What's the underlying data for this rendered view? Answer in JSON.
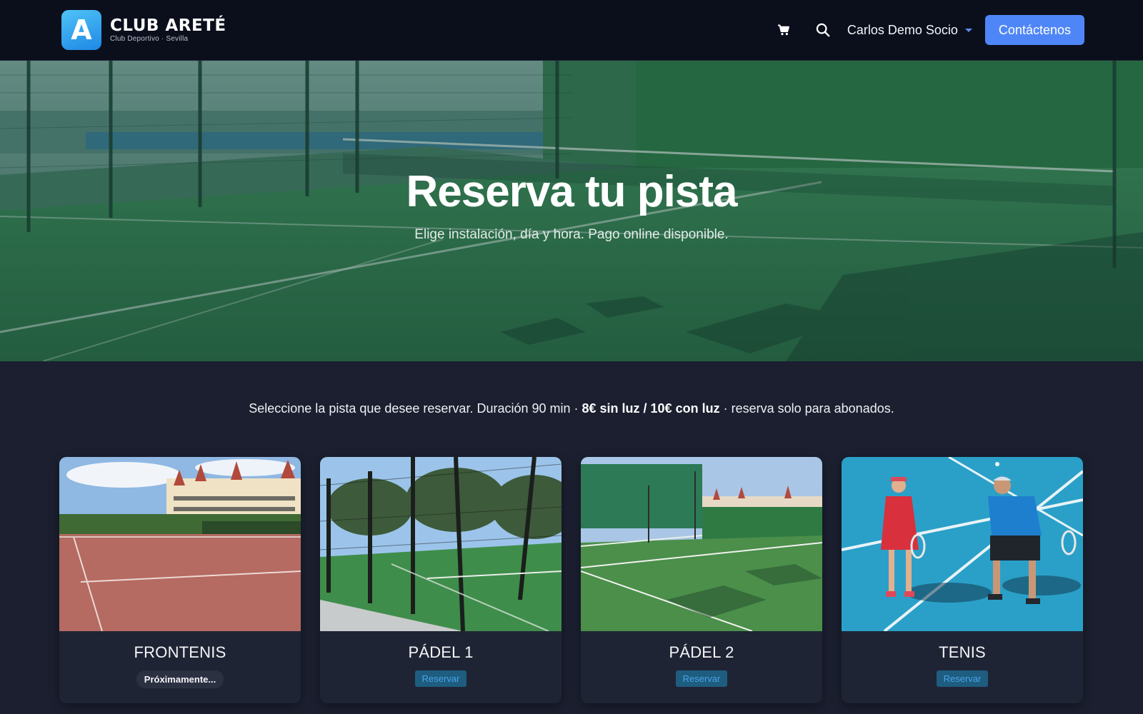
{
  "brand": {
    "logo_letter": "A",
    "name": "CLUB ARETÉ",
    "tagline": "Club Deportivo · Sevilla"
  },
  "nav": {
    "cart_icon": "cart-icon",
    "search_icon": "search-icon",
    "user_name": "Carlos Demo Socio",
    "contact_label": "Contáctenos"
  },
  "hero": {
    "title": "Reserva tu pista",
    "subtitle": "Elige instalación, día y hora. Pago online disponible."
  },
  "intro": {
    "text_before": "Seleccione la pista que desee reservar. Duración 90 min · ",
    "text_bold": "8€ sin luz / 10€ con luz",
    "text_after": " · reserva solo para abonados."
  },
  "courts": [
    {
      "title": "FRONTENIS",
      "action": "Próximamente...",
      "available": false
    },
    {
      "title": "PÁDEL 1",
      "action": "Reservar",
      "available": true
    },
    {
      "title": "PÁDEL 2",
      "action": "Reservar",
      "available": true
    },
    {
      "title": "TENIS",
      "action": "Reservar",
      "available": true
    }
  ],
  "colors": {
    "accent": "#4f86f7",
    "navbar_bg": "#0b0f1c",
    "page_bg": "#1b1f2f",
    "reserve_button_bg": "#1e5d80"
  }
}
